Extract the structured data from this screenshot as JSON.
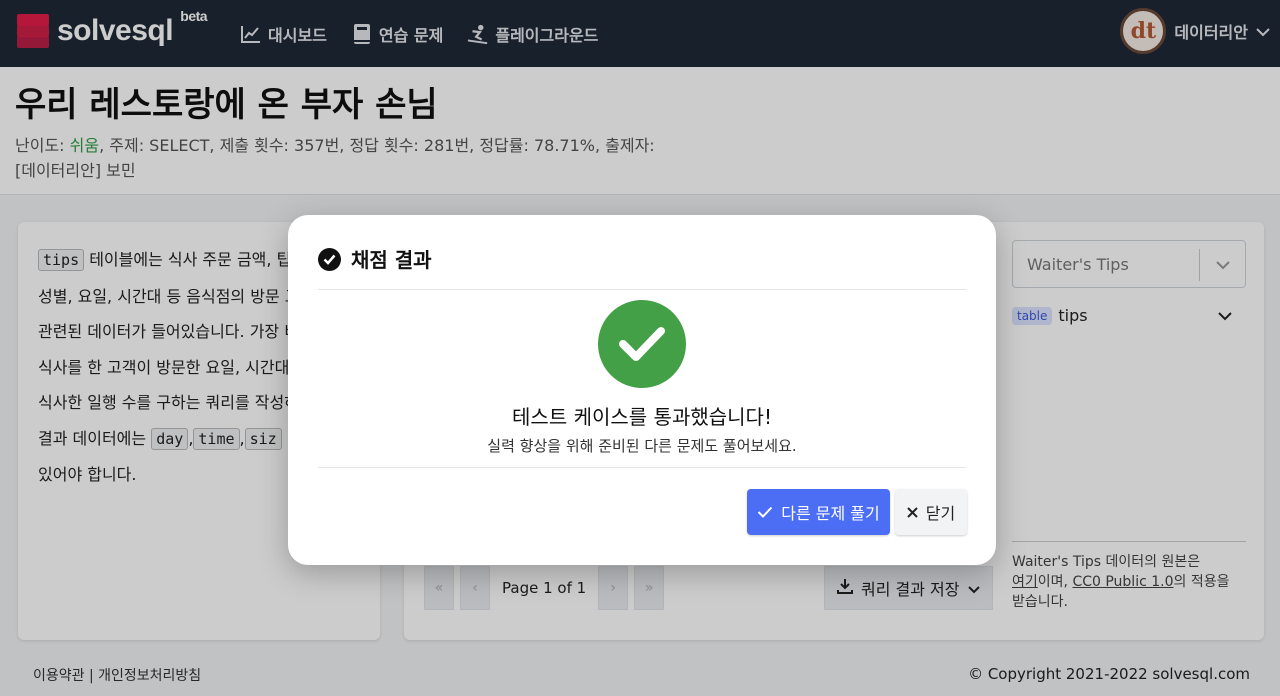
{
  "brand": {
    "name": "solvesql",
    "tag": "beta",
    "accent": "#e11d48"
  },
  "nav": {
    "items": [
      {
        "label": "대시보드",
        "icon": "chart-line-icon"
      },
      {
        "label": "연습 문제",
        "icon": "book-icon"
      },
      {
        "label": "플레이그라운드",
        "icon": "snowboarding-icon"
      }
    ],
    "user": {
      "name": "데이터리안",
      "avatar_text": "dt"
    }
  },
  "problem": {
    "title": "우리 레스토랑에 온 부자 손님",
    "meta_prefix": "난이도: ",
    "difficulty": "쉬움",
    "meta_rest": ", 주제: SELECT, 제출 횟수: 357번, 정답 횟수: 281번, 정답률: 78.71%, 출제자:",
    "author": "[데이터리안] 보민",
    "easy_color": "#2f9e44"
  },
  "description": {
    "code_tips": "tips",
    "line1": " 테이블에는 식사 주문 금액, 팁",
    "line2": "성별, 요일, 시간대 등 음식점의 방문 고",
    "line3": "관련된 데이터가 들어있습니다. 가장 비",
    "line4": "식사를 한 고객이 방문한 요일, 시간대,",
    "line5": "식사한 일행 수를 구하는 쿼리를 작성하",
    "line6_prefix": "결과 데이터에는 ",
    "code_day": "day",
    "sep1": ",",
    "code_time": "time",
    "sep2": ",",
    "code_size": "siz",
    "line7": "있어야 합니다."
  },
  "pagination": {
    "first": "«",
    "prev": "‹",
    "text": "Page 1 of 1",
    "next": "›",
    "last": "»"
  },
  "save_button": "쿼리 결과 저장",
  "dataset": {
    "selected": "Waiter's Tips",
    "table_tag": "table",
    "table_name": "tips",
    "source_line1": "Waiter's Tips 데이터의 원본은",
    "source_link1": "여기",
    "source_mid": "이며, ",
    "source_link2": "CC0 Public 1.0",
    "source_line2b": "의 적용을",
    "source_line3": "받습니다."
  },
  "footer": {
    "left": "이용약관 | 개인정보처리방침",
    "right": "© Copyright 2021-2022 solvesql.com"
  },
  "modal": {
    "title": "채점 결과",
    "result_title": "테스트 케이스를 통과했습니다!",
    "result_sub": "실력 향상을 위해 준비된 다른 문제도 풀어보세요.",
    "primary_button": "다른 문제 풀기",
    "close_button": "닫기",
    "success_color": "#43a047",
    "primary_color": "#4c6ef5"
  }
}
